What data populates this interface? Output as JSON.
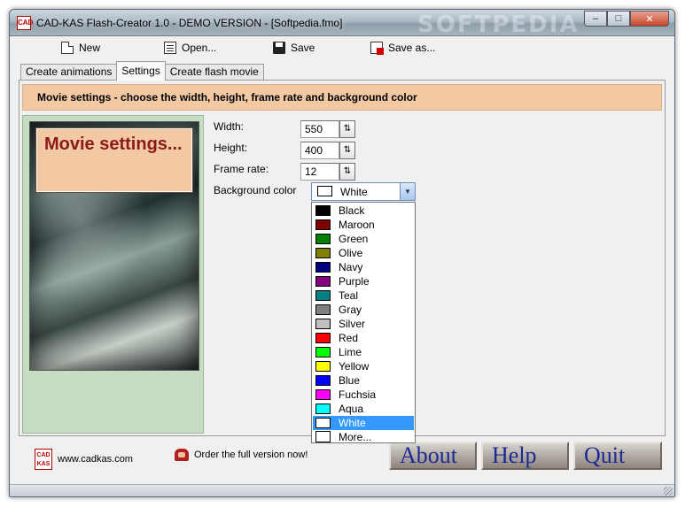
{
  "window": {
    "title": "CAD-KAS Flash-Creator 1.0 - DEMO VERSION - [Softpedia.fmo]",
    "watermark": "SOFTPEDIA",
    "icon_text": "CAD",
    "minimize": "–",
    "maximize": "□",
    "close": "✕"
  },
  "toolbar": {
    "new_label": "New",
    "open_label": "Open...",
    "save_label": "Save",
    "saveas_label": "Save as..."
  },
  "tabs": [
    {
      "label": "Create animations"
    },
    {
      "label": "Settings"
    },
    {
      "label": "Create flash movie"
    }
  ],
  "banner": {
    "text": "Movie settings - choose the width, height, frame rate and background color"
  },
  "side": {
    "label": "Movie settings..."
  },
  "fields": {
    "width_label": "Width:",
    "width_value": "550",
    "height_label": "Height:",
    "height_value": "400",
    "framerate_label": "Frame rate:",
    "framerate_value": "12",
    "bgcolor_label": "Background color",
    "spin_glyph": "⇅"
  },
  "combo": {
    "selected": "White",
    "selected_color": "#ffffff",
    "arrow": "▼"
  },
  "colors": [
    {
      "name": "Black",
      "hex": "#000000"
    },
    {
      "name": "Maroon",
      "hex": "#800000"
    },
    {
      "name": "Green",
      "hex": "#008000"
    },
    {
      "name": "Olive",
      "hex": "#808000"
    },
    {
      "name": "Navy",
      "hex": "#000080"
    },
    {
      "name": "Purple",
      "hex": "#800080"
    },
    {
      "name": "Teal",
      "hex": "#008080"
    },
    {
      "name": "Gray",
      "hex": "#808080"
    },
    {
      "name": "Silver",
      "hex": "#c0c0c0"
    },
    {
      "name": "Red",
      "hex": "#ff0000"
    },
    {
      "name": "Lime",
      "hex": "#00ff00"
    },
    {
      "name": "Yellow",
      "hex": "#ffff00"
    },
    {
      "name": "Blue",
      "hex": "#0000ff"
    },
    {
      "name": "Fuchsia",
      "hex": "#ff00ff"
    },
    {
      "name": "Aqua",
      "hex": "#00ffff"
    },
    {
      "name": "White",
      "hex": "#ffffff"
    }
  ],
  "more_label": "More...",
  "footer": {
    "website": "www.cadkas.com",
    "order": "Order the full version now!",
    "logo_text": "CAD KAS",
    "about": "About",
    "help": "Help",
    "quit": "Quit"
  },
  "accent": {
    "banner_bg": "#f2c9a3",
    "side_bg": "#c6dcc3",
    "selection": "#3399ff",
    "big_btn_text": "#1c2a94"
  }
}
